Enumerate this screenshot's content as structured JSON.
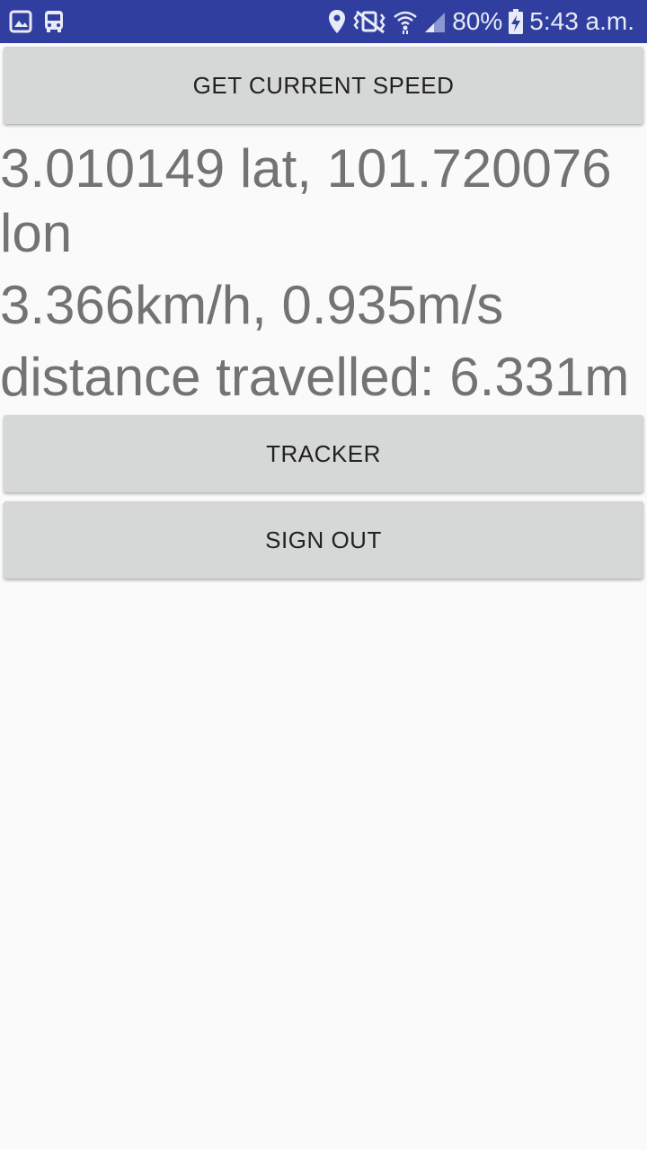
{
  "status_bar": {
    "background": "#303f9f",
    "left_icons": [
      "gallery-icon",
      "bus-icon"
    ],
    "right_icons": [
      "location-pin-icon",
      "vibrate-mute-icon",
      "wifi-icon",
      "cell-signal-icon"
    ],
    "battery_percent": "80%",
    "battery_icon": "battery-charging-icon",
    "time": "5:43 a.m."
  },
  "main": {
    "get_speed_label": "GET CURRENT SPEED",
    "location_text": "3.010149 lat, 101.720076 lon",
    "speed_text": "3.366km/h, 0.935m/s",
    "distance_text": "distance travelled: 6.331m",
    "tracker_label": "TRACKER",
    "sign_out_label": "SIGN OUT"
  }
}
